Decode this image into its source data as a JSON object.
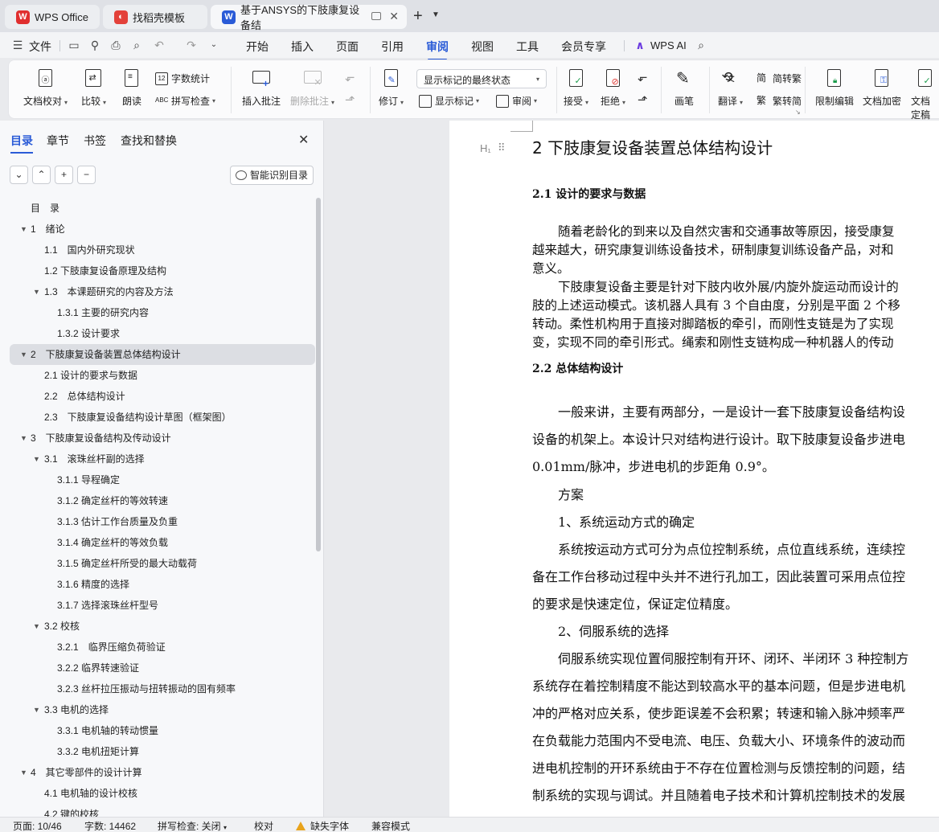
{
  "tabs": [
    {
      "label": "WPS Office",
      "icon": "wps-logo-icon",
      "color": "#e02f2f"
    },
    {
      "label": "找稻壳模板",
      "icon": "docer-icon",
      "color": "#e3413a"
    },
    {
      "label": "基于ANSYS的下肢康复设备结",
      "icon": "word-doc-icon",
      "color": "#2a5bd7"
    }
  ],
  "menu": {
    "file": "文件",
    "items": [
      "开始",
      "插入",
      "页面",
      "引用",
      "审阅",
      "视图",
      "工具",
      "会员专享"
    ],
    "active": "审阅",
    "wps_ai": "WPS AI"
  },
  "ribbon": {
    "doc_check": "文档校对",
    "compare": "比较",
    "read_aloud": "朗读",
    "word_count": "字数统计",
    "spell_check": "拼写检查",
    "insert_comment": "插入批注",
    "delete_comment": "删除批注",
    "revise": "修订",
    "markup_mode": "显示标记的最终状态",
    "show_markup": "显示标记",
    "review": "审阅",
    "accept": "接受",
    "reject": "拒绝",
    "pen": "画笔",
    "translate": "翻译",
    "to_traditional": "简转繁",
    "to_simplified": "繁转简",
    "restrict_edit": "限制编辑",
    "doc_encrypt": "文档加密",
    "doc_final": "文档定稿"
  },
  "panel": {
    "tabs": [
      "目录",
      "章节",
      "书签",
      "查找和替换"
    ],
    "active_tab": "目录",
    "smart_toc": "智能识别目录"
  },
  "toc": [
    {
      "text": "目　录",
      "level": 0,
      "expand": false
    },
    {
      "text": "1　绪论",
      "level": 1,
      "expand": true
    },
    {
      "text": "1.1　国内外研究现状",
      "level": 2,
      "expand": false
    },
    {
      "text": "1.2 下肢康复设备原理及结构",
      "level": 2,
      "expand": false
    },
    {
      "text": "1.3　本课题研究的内容及方法",
      "level": 2,
      "expand": true
    },
    {
      "text": "1.3.1 主要的研究内容",
      "level": 3,
      "expand": false
    },
    {
      "text": "1.3.2 设计要求",
      "level": 3,
      "expand": false
    },
    {
      "text": "2　下肢康复设备装置总体结构设计",
      "level": 1,
      "expand": true,
      "selected": true
    },
    {
      "text": "2.1 设计的要求与数据",
      "level": 2,
      "expand": false
    },
    {
      "text": "2.2　总体结构设计",
      "level": 2,
      "expand": false
    },
    {
      "text": "2.3　下肢康复设备结构设计草图（框架图）",
      "level": 2,
      "expand": false
    },
    {
      "text": "3　下肢康复设备结构及传动设计",
      "level": 1,
      "expand": true
    },
    {
      "text": "3.1　滚珠丝杆副的选择",
      "level": 2,
      "expand": true
    },
    {
      "text": "3.1.1 导程确定",
      "level": 3,
      "expand": false
    },
    {
      "text": "3.1.2 确定丝杆的等效转速",
      "level": 3,
      "expand": false
    },
    {
      "text": "3.1.3 估计工作台质量及负重",
      "level": 3,
      "expand": false
    },
    {
      "text": "3.1.4 确定丝杆的等效负载",
      "level": 3,
      "expand": false
    },
    {
      "text": "3.1.5 确定丝杆所受的最大动载荷",
      "level": 3,
      "expand": false
    },
    {
      "text": "3.1.6 精度的选择",
      "level": 3,
      "expand": false
    },
    {
      "text": "3.1.7 选择滚珠丝杆型号",
      "level": 3,
      "expand": false
    },
    {
      "text": "3.2 校核",
      "level": 2,
      "expand": true
    },
    {
      "text": "3.2.1　临界压缩负荷验证",
      "level": 3,
      "expand": false
    },
    {
      "text": "3.2.2 临界转速验证",
      "level": 3,
      "expand": false
    },
    {
      "text": "3.2.3 丝杆拉压振动与扭转振动的固有频率",
      "level": 3,
      "expand": false
    },
    {
      "text": "3.3 电机的选择",
      "level": 2,
      "expand": true
    },
    {
      "text": "3.3.1 电机轴的转动惯量",
      "level": 3,
      "expand": false
    },
    {
      "text": "3.3.2 电机扭矩计算",
      "level": 3,
      "expand": false
    },
    {
      "text": "4　其它零部件的设计计算",
      "level": 1,
      "expand": true
    },
    {
      "text": "4.1 电机轴的设计校核",
      "level": 2,
      "expand": false
    },
    {
      "text": "4.2 键的校核",
      "level": 2,
      "expand": false
    }
  ],
  "document": {
    "heading": "2  下肢康复设备装置总体结构设计",
    "section_2_1": "2.1 设计的要求与数据",
    "p1_line1": "随着老龄化的到来以及自然灾害和交通事故等原因，接受康复",
    "p1_line2": "越来越大，研究康复训练设备技术，研制康复训练设备产品，对和",
    "p1_line3": "意义。",
    "p2_line1": "下肢康复设备主要是针对下肢内收外展/内旋外旋运动而设计的",
    "p2_line2": "肢的上述运动模式。该机器人具有 3 个自由度，分别是平面 2 个移",
    "p2_line3": "转动。柔性机构用于直接对脚踏板的牵引，而刚性支链是为了实现",
    "p2_line4": "变，实现不同的牵引形式。绳索和刚性支链构成一种机器人的传动",
    "section_2_2": "2.2  总体结构设计",
    "p3_line1": "一般来讲，主要有两部分，一是设计一套下肢康复设备结构设",
    "p3_line2": "设备的机架上。本设计只对结构进行设计。取下肢康复设备步进电",
    "p3_line3": "0.01mm/脉冲，步进电机的步距角 0.9°。",
    "p4": "方案",
    "p5": "1、系统运动方式的确定",
    "p6_line1": "系统按运动方式可分为点位控制系统，点位直线系统，连续控",
    "p6_line2": "备在工作台移动过程中头并不进行孔加工，因此装置可采用点位控",
    "p6_line3": "的要求是快速定位，保证定位精度。",
    "p7": "2、伺服系统的选择",
    "p8_line1": "伺服系统实现位置伺服控制有开环、闭环、半闭环 3 种控制方",
    "p8_line2": "系统存在着控制精度不能达到较高水平的基本问题，但是步进电机",
    "p8_line3": "冲的严格对应关系，使步距误差不会积累；转速和输入脉冲频率严",
    "p8_line4": "在负载能力范围内不受电流、电压、负载大小、环境条件的波动而",
    "p8_line5": "进电机控制的开环系统由于不存在位置检测与反馈控制的问题，结",
    "p8_line6": "制系统的实现与调试。并且随着电子技术和计算机控制技术的发展"
  },
  "status": {
    "page": "页面: 10/46",
    "words": "字数: 14462",
    "spell": "拼写检查: 关闭",
    "proof": "校对",
    "missing_font": "缺失字体",
    "compat": "兼容模式"
  },
  "colors": {
    "accent": "#2a5bd7",
    "warning": "#e8a31b"
  }
}
